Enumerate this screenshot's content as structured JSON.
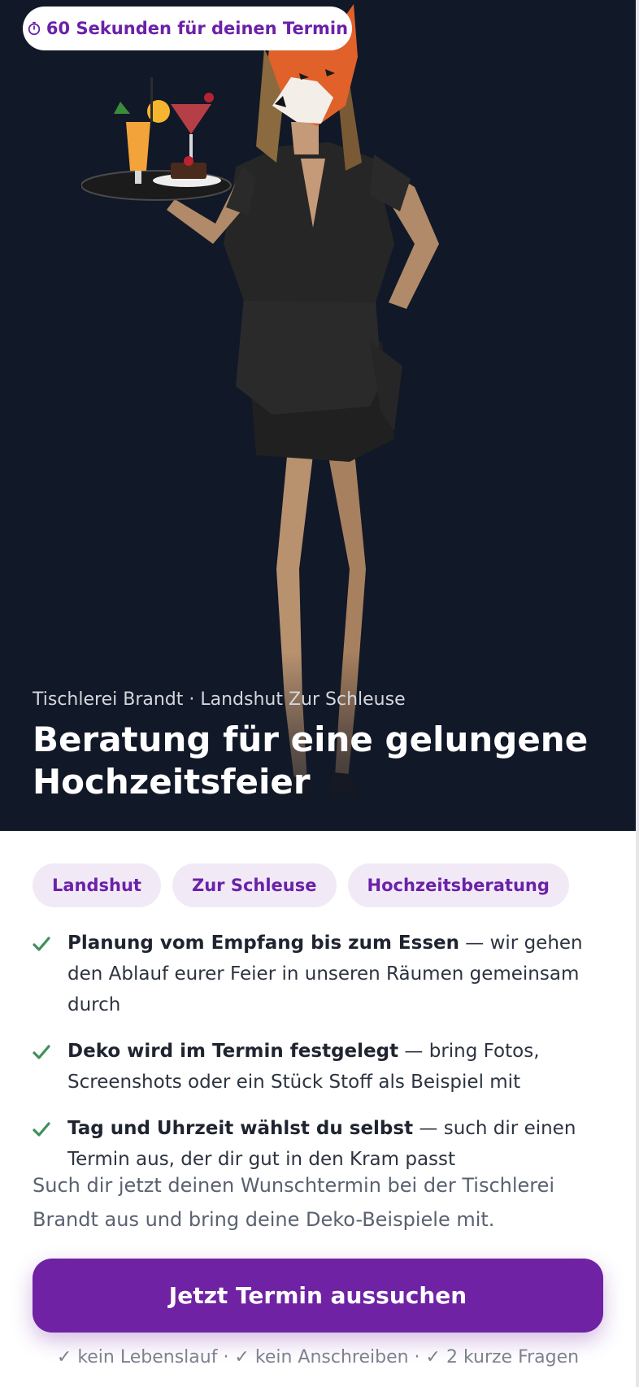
{
  "badge": {
    "icon": "stopwatch-icon",
    "label": "60 Sekunden für deinen Termin"
  },
  "hero": {
    "subtitle": "Tischlerei Brandt · Landshut Zur Schleuse",
    "title": "Beratung für eine gelungene Hochzeitsfeier"
  },
  "tags": [
    "Landshut",
    "Zur Schleuse",
    "Hochzeitsberatung"
  ],
  "benefits": [
    {
      "bold": "Planung vom Empfang bis zum Essen",
      "text": " — wir gehen den Ablauf eurer Feier in unseren Räumen gemeinsam durch"
    },
    {
      "bold": "Deko wird im Termin festgelegt",
      "text": " — bring Fotos, Screenshots oder ein Stück Stoff als Beispiel mit"
    },
    {
      "bold": "Tag und Uhrzeit wählst du selbst",
      "text": " — such dir einen Termin aus, der dir gut in den Kram passt"
    }
  ],
  "cta_text": "Such dir jetzt deinen Wunschtermin bei der Tischlerei Brandt aus und bring deine Deko-Beispiele mit.",
  "cta_button": "Jetzt Termin aussuchen",
  "footnote": "✓ kein Lebenslauf · ✓ kein Anschreiben · ✓ 2 kurze Fragen",
  "colors": {
    "hero_bg": "#111827",
    "accent": "#6f22a3",
    "tag_bg": "#f1eaf6",
    "check": "#3f8f5a"
  }
}
